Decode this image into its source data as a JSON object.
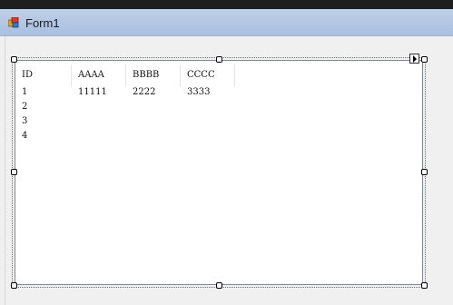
{
  "window": {
    "title": "Form1"
  },
  "listview": {
    "columns": [
      "ID",
      "AAAA",
      "BBBB",
      "CCCC"
    ],
    "rows": [
      [
        "1",
        "11111",
        "2222",
        "3333"
      ],
      [
        "2",
        "",
        "",
        ""
      ],
      [
        "3",
        "",
        "",
        ""
      ],
      [
        "4",
        "",
        "",
        ""
      ]
    ]
  },
  "colors": {
    "titlebar": "#bfcfe7",
    "form_background": "#f0f0f0",
    "list_background": "#ffffff"
  }
}
